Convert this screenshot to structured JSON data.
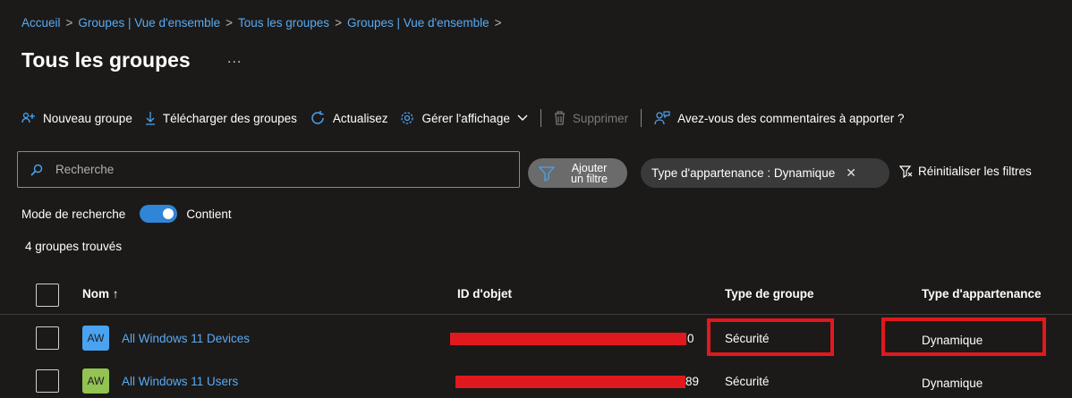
{
  "breadcrumb": [
    {
      "label": "Accueil"
    },
    {
      "label": "Groupes | Vue d'ensemble"
    },
    {
      "label": "Tous les groupes"
    },
    {
      "label": "Groupes | Vue d'ensemble"
    }
  ],
  "breadcrumb_separator": ">",
  "page": {
    "title": "Tous les groupes",
    "more": "..."
  },
  "toolbar": {
    "new_group": "Nouveau groupe",
    "download": "Télécharger des groupes",
    "refresh": "Actualisez",
    "manage_view": "Gérer l'affichage",
    "delete": "Supprimer",
    "feedback": "Avez-vous des commentaires à apporter ?"
  },
  "search": {
    "placeholder": "Recherche"
  },
  "filters": {
    "add_filter_line1": "Ajouter",
    "add_filter_line2": "un filtre",
    "active_filter": "Type d'appartenance : Dynamique",
    "remove": "✕",
    "reset": "Réinitialiser les filtres"
  },
  "search_mode": {
    "label": "Mode de recherche",
    "value": "Contient",
    "enabled": true
  },
  "results": {
    "count_text": "4 groupes trouvés"
  },
  "table": {
    "columns": {
      "name": "Nom ↑",
      "object_id": "ID d'objet",
      "group_type": "Type de groupe",
      "membership_type": "Type d'appartenance"
    },
    "rows": [
      {
        "avatar": "AW",
        "avatar_color": "#4aa3f0",
        "name": "All Windows 11 Devices",
        "object_id_visible": "0",
        "group_type": "Sécurité",
        "membership_type": "Dynamique"
      },
      {
        "avatar": "AW",
        "avatar_color": "#92c353",
        "name": "All Windows 11 Users",
        "object_id_visible": "89",
        "group_type": "Sécurité",
        "membership_type": "Dynamique"
      }
    ]
  },
  "colors": {
    "accent": "#4aa3f0",
    "annotation": "#e0191e",
    "background": "#1b1a19"
  }
}
